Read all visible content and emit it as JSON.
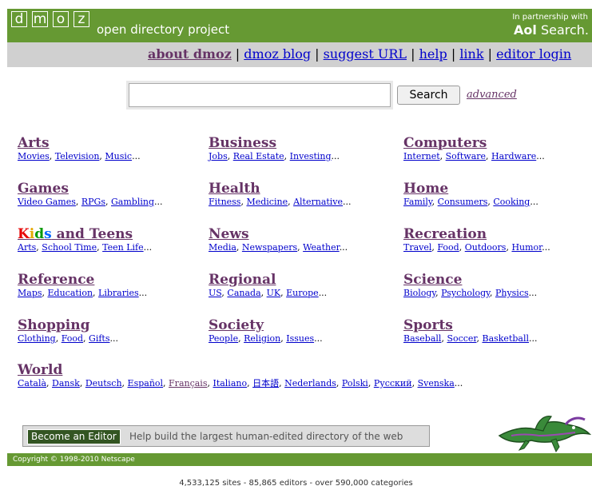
{
  "header": {
    "logo_letters": [
      "d",
      "m",
      "o",
      "z"
    ],
    "logo_text": "open directory project",
    "partner_small": "In partnership with",
    "partner_brand_bold": "Aol",
    "partner_brand_rest": " Search."
  },
  "nav": {
    "about": "about dmoz",
    "blog": "dmoz blog",
    "suggest": "suggest URL",
    "help": "help",
    "link": "link",
    "editor_login": "editor login",
    "separator": "|"
  },
  "search": {
    "value": "",
    "button_label": "Search",
    "advanced_label": "advanced"
  },
  "categories": {
    "arts": {
      "title": "Arts",
      "subs": [
        "Movies",
        "Television",
        "Music"
      ]
    },
    "business": {
      "title": "Business",
      "subs": [
        "Jobs",
        "Real Estate",
        "Investing"
      ]
    },
    "computers": {
      "title": "Computers",
      "subs": [
        "Internet",
        "Software",
        "Hardware"
      ]
    },
    "games": {
      "title": "Games",
      "subs": [
        "Video Games",
        "RPGs",
        "Gambling"
      ]
    },
    "health": {
      "title": "Health",
      "subs": [
        "Fitness",
        "Medicine",
        "Alternative"
      ]
    },
    "home": {
      "title": "Home",
      "subs": [
        "Family",
        "Consumers",
        "Cooking"
      ]
    },
    "kids": {
      "title_k": "K",
      "title_i": "i",
      "title_d": "d",
      "title_s": "s",
      "title_rest": " and Teens",
      "subs": [
        "Arts",
        "School Time",
        "Teen Life"
      ]
    },
    "news": {
      "title": "News",
      "subs": [
        "Media",
        "Newspapers",
        "Weather"
      ]
    },
    "recreation": {
      "title": "Recreation",
      "subs": [
        "Travel",
        "Food",
        "Outdoors",
        "Humor"
      ]
    },
    "reference": {
      "title": "Reference",
      "subs": [
        "Maps",
        "Education",
        "Libraries"
      ]
    },
    "regional": {
      "title": "Regional",
      "subs": [
        "US",
        "Canada",
        "UK",
        "Europe"
      ]
    },
    "science": {
      "title": "Science",
      "subs": [
        "Biology",
        "Psychology",
        "Physics"
      ]
    },
    "shopping": {
      "title": "Shopping",
      "subs": [
        "Clothing",
        "Food",
        "Gifts"
      ]
    },
    "society": {
      "title": "Society",
      "subs": [
        "People",
        "Religion",
        "Issues"
      ]
    },
    "sports": {
      "title": "Sports",
      "subs": [
        "Baseball",
        "Soccer",
        "Basketball"
      ]
    },
    "world": {
      "title": "World",
      "subs": [
        "Català",
        "Dansk",
        "Deutsch",
        "Español",
        "Français",
        "Italiano",
        "日本語",
        "Nederlands",
        "Polski",
        "Русский",
        "Svenska"
      ]
    }
  },
  "editor": {
    "button_label": "Become an Editor",
    "text": "Help build the largest human-edited directory of the web"
  },
  "footer": {
    "copyright": "Copyright © 1998-2010 Netscape"
  },
  "stats": "4,533,125 sites - 85,865 editors - over 590,000 categories",
  "colors": {
    "header_green": "#669933",
    "nav_gray": "#d0d0d0",
    "link_blue": "#0000cc",
    "visited_purple": "#663366"
  },
  "icons": {
    "mascot": "dmoz-lizard-mascot"
  }
}
